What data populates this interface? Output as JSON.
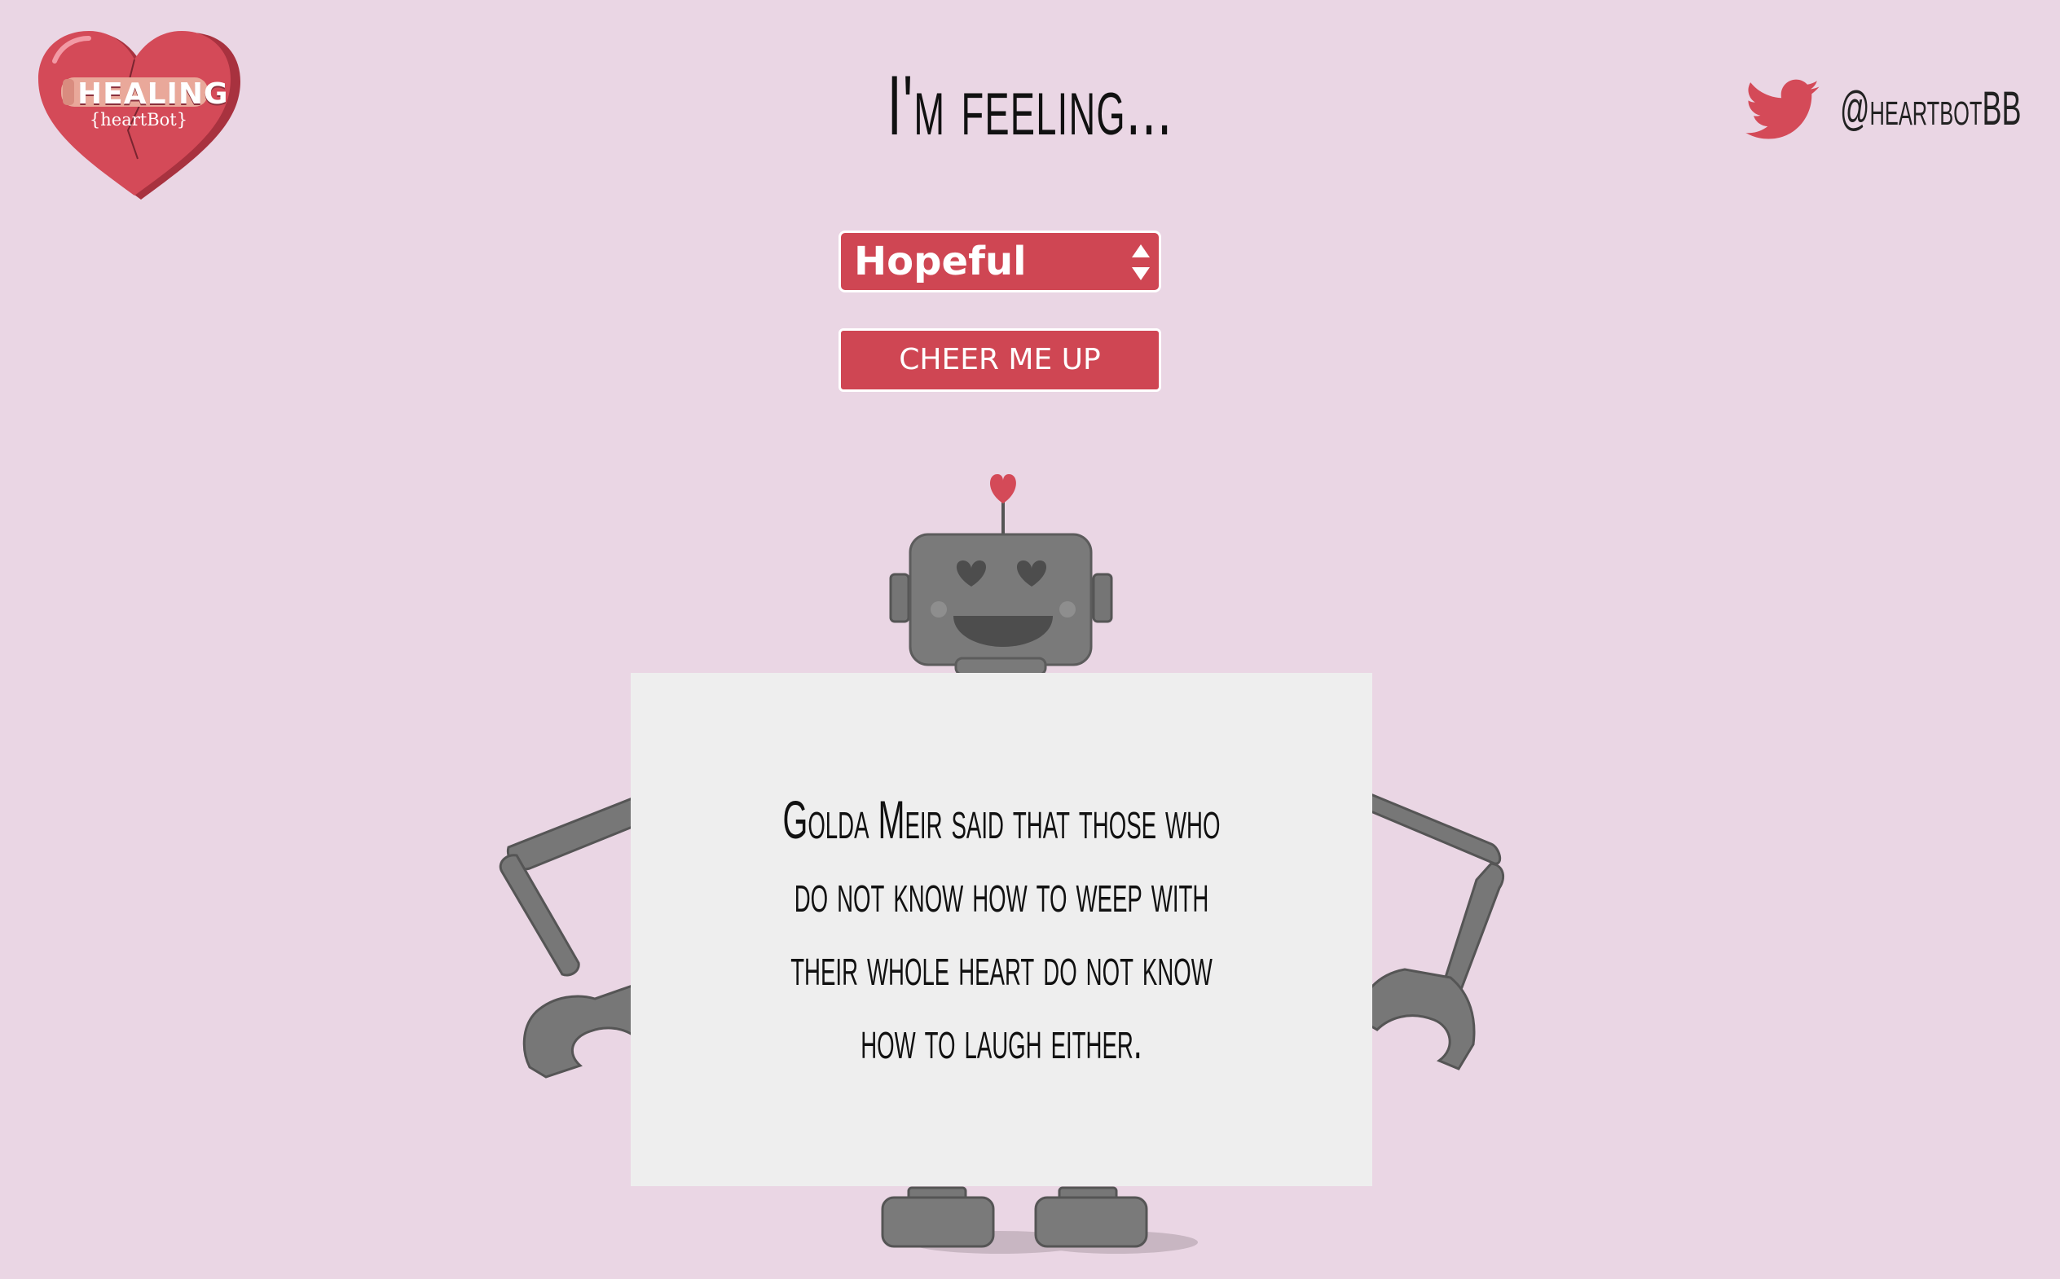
{
  "logo": {
    "line1": "HEALING",
    "line2": "{heartBot}"
  },
  "header": {
    "title": "I'm feeling..."
  },
  "social": {
    "icon": "twitter-bird-icon",
    "handle": "@heartbotBB"
  },
  "mood_select": {
    "value": "Hopeful"
  },
  "cheer_button": {
    "label": "CHEER ME UP"
  },
  "quote": {
    "text": "Golda Meir said that those who do not know how to weep with their whole heart do not know how to laugh either."
  },
  "colors": {
    "background": "#ead6e4",
    "accent": "#cf4653",
    "card": "#eeeeee",
    "robot_gray": "#757575"
  }
}
